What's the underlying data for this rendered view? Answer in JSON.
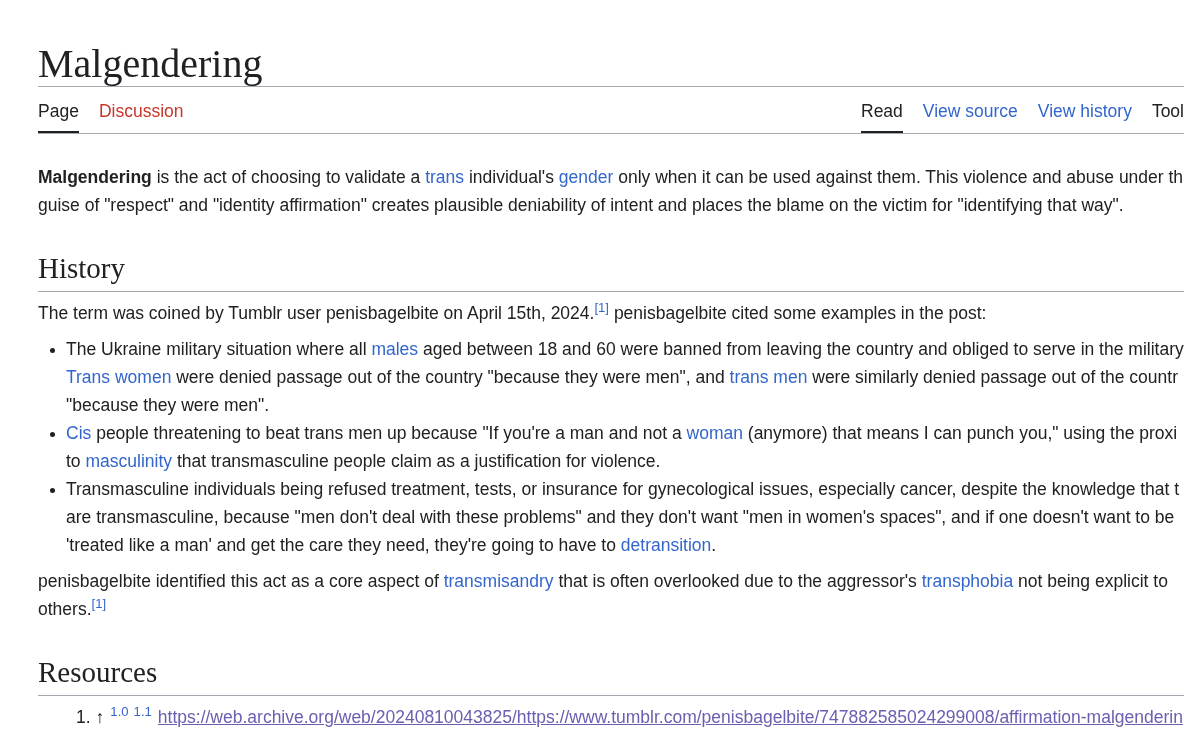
{
  "title": "Malgendering",
  "namespace_tabs": [
    {
      "label": "Page",
      "selected": true,
      "exists": true
    },
    {
      "label": "Discussion",
      "selected": false,
      "exists": false
    }
  ],
  "view_tabs": [
    {
      "label": "Read",
      "kind": "tab",
      "selected": true
    },
    {
      "label": "View source",
      "kind": "tab",
      "selected": false
    },
    {
      "label": "View history",
      "kind": "tab",
      "selected": false
    },
    {
      "label": "Tool",
      "kind": "menu",
      "selected": false
    }
  ],
  "lead": {
    "lines": [
      [
        {
          "kind": "bold",
          "text": "Malgendering"
        },
        {
          "kind": "text",
          "text": " is the act of choosing to validate a "
        },
        {
          "kind": "link",
          "text": "trans"
        },
        {
          "kind": "text",
          "text": " individual's "
        },
        {
          "kind": "link",
          "text": "gender"
        },
        {
          "kind": "text",
          "text": " only when it can be used against them. This violence and abuse under th"
        }
      ],
      [
        {
          "kind": "text",
          "text": "guise of \"respect\" and \"identity affirmation\" creates plausible deniability of intent and places the blame on the victim for \"identifying that way\"."
        }
      ]
    ]
  },
  "sections": [
    {
      "heading": "History",
      "blocks": [
        {
          "kind": "paragraph",
          "lines": [
            [
              {
                "kind": "text",
                "text": "The term was coined by Tumblr user penisbagelbite on April 15th, 2024."
              },
              {
                "kind": "ref",
                "text": "[1]"
              },
              {
                "kind": "text",
                "text": " penisbagelbite cited some examples in the post:"
              }
            ]
          ]
        },
        {
          "kind": "bullets",
          "items": [
            {
              "lines": [
                [
                  {
                    "kind": "text",
                    "text": "The Ukraine military situation where all "
                  },
                  {
                    "kind": "link",
                    "text": "males"
                  },
                  {
                    "kind": "text",
                    "text": " aged between 18 and 60 were banned from leaving the country and obliged to serve in the military"
                  }
                ],
                [
                  {
                    "kind": "link",
                    "text": "Trans women"
                  },
                  {
                    "kind": "text",
                    "text": " were denied passage out of the country \"because they were men\", and "
                  },
                  {
                    "kind": "link",
                    "text": "trans men"
                  },
                  {
                    "kind": "text",
                    "text": " were similarly denied passage out of the countr"
                  }
                ],
                [
                  {
                    "kind": "text",
                    "text": "\"because they were men\"."
                  }
                ]
              ]
            },
            {
              "lines": [
                [
                  {
                    "kind": "link",
                    "text": "Cis"
                  },
                  {
                    "kind": "text",
                    "text": " people threatening to beat trans men up because \"If you're a man and not a "
                  },
                  {
                    "kind": "link",
                    "text": "woman"
                  },
                  {
                    "kind": "text",
                    "text": " (anymore) that means I can punch you,\" using the proxi"
                  }
                ],
                [
                  {
                    "kind": "text",
                    "text": "to "
                  },
                  {
                    "kind": "link",
                    "text": "masculinity"
                  },
                  {
                    "kind": "text",
                    "text": " that transmasculine people claim as a justification for violence."
                  }
                ]
              ]
            },
            {
              "lines": [
                [
                  {
                    "kind": "text",
                    "text": "Transmasculine individuals being refused treatment, tests, or insurance for gynecological issues, especially cancer, despite the knowledge that t"
                  }
                ],
                [
                  {
                    "kind": "text",
                    "text": "are transmasculine, because \"men don't deal with these problems\" and they don't want \"men in women's spaces\", and if one doesn't want to be"
                  }
                ],
                [
                  {
                    "kind": "text",
                    "text": "'treated like a man' and get the care they need, they're going to have to "
                  },
                  {
                    "kind": "link",
                    "text": "detransition"
                  },
                  {
                    "kind": "text",
                    "text": "."
                  }
                ]
              ]
            }
          ]
        },
        {
          "kind": "paragraph",
          "lines": [
            [
              {
                "kind": "text",
                "text": "penisbagelbite identified this act as a core aspect of "
              },
              {
                "kind": "link",
                "text": "transmisandry"
              },
              {
                "kind": "text",
                "text": " that is often overlooked due to the aggressor's "
              },
              {
                "kind": "link",
                "text": "transphobia"
              },
              {
                "kind": "text",
                "text": " not being explicit to"
              }
            ],
            [
              {
                "kind": "text",
                "text": "others."
              },
              {
                "kind": "ref",
                "text": "[1]"
              }
            ]
          ]
        }
      ]
    },
    {
      "heading": "Resources",
      "blocks": [
        {
          "kind": "references",
          "items": [
            {
              "number": "1.",
              "backlink": "↑",
              "backrefs": [
                "1.0",
                "1.1"
              ],
              "url": "https://web.archive.org/web/20240810043825/https://www.tumblr.com/penisbagelbite/747882585024299008/affirmation-malgenderin"
            }
          ]
        }
      ]
    }
  ]
}
